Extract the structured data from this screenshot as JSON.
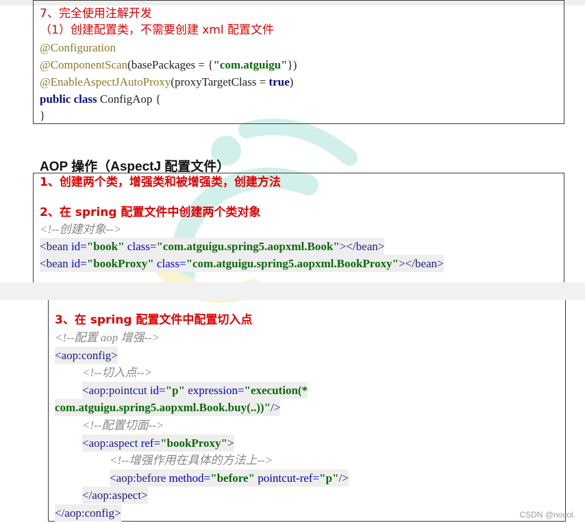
{
  "section7": {
    "title": "7、完全使用注解开发",
    "subtitle": "（1）创建配置类，不需要创建 xml 配置文件",
    "code": {
      "ann1": "@Configuration",
      "ann2": "@ComponentScan",
      "ann2_args_a": "(basePackages = {",
      "ann2_str": "\"com.atguigu\"",
      "ann2_args_b": "})",
      "ann3": "@EnableAspectJAutoProxy",
      "ann3_args_a": "(proxyTargetClass = ",
      "ann3_true": "true",
      "ann3_args_b": ")",
      "kw_public": "public",
      "kw_class": "class",
      "class_name": " ConfigAop {",
      "close_brace": "}"
    }
  },
  "section_aop": {
    "heading": "AOP 操作（AspectJ 配置文件）",
    "step1": "1、创建两个类，增强类和被增强类，创建方法",
    "step2": "2、在 spring 配置文件中创建两个类对象",
    "comment_create": "<!--创建对象-->",
    "bean1": {
      "open": "<bean ",
      "id_attr": "id=",
      "id_val": "\"book\"",
      "class_attr": " class=",
      "class_val": "\"com.atguigu.spring5.aopxml.Book\"",
      "close": "></bean>"
    },
    "bean2": {
      "open": "<bean ",
      "id_attr": "id=",
      "id_val": "\"bookProxy\"",
      "class_attr": " class=",
      "class_val": "\"com.atguigu.spring5.aopxml.BookProxy\"",
      "close": "></bean>"
    }
  },
  "section3": {
    "step3": "3、在 spring 配置文件中配置切入点",
    "comment_aop": "<!--配置 aop 增强-->",
    "aop_config_open": "<aop:config>",
    "comment_pointcut": "<!--切入点-->",
    "pointcut_open": "<aop:pointcut ",
    "pointcut_id_attr": "id=",
    "pointcut_id_val": "\"p\"",
    "pointcut_expr_attr": " expression=",
    "pointcut_expr_val_a": "\"execution(*",
    "pointcut_expr_val_b": "com.atguigu.spring5.aopxml.Book.buy(..))\"",
    "pointcut_close": "/>",
    "comment_aspect": "<!--配置切面-->",
    "aspect_open": "<aop:aspect ",
    "aspect_ref_attr": "ref=",
    "aspect_ref_val": "\"bookProxy\"",
    "aspect_open_end": ">",
    "comment_before": "<!--增强作用在具体的方法上-->",
    "before_open": "<aop:before ",
    "before_method_attr": "method=",
    "before_method_val": "\"before\"",
    "before_pc_attr": " pointcut-ref=",
    "before_pc_val": "\"p\"",
    "before_close": "/>",
    "aspect_close": "</aop:aspect>",
    "aop_config_close": "</aop:config>"
  },
  "watermark_note": "",
  "footer": {
    "credit": "CSDN @nocol."
  },
  "colors": {
    "red": "#e00000",
    "annotation": "#8a7a2a",
    "keyword": "#0a0a8c",
    "comment": "#888888",
    "attr": "#0000cc"
  }
}
